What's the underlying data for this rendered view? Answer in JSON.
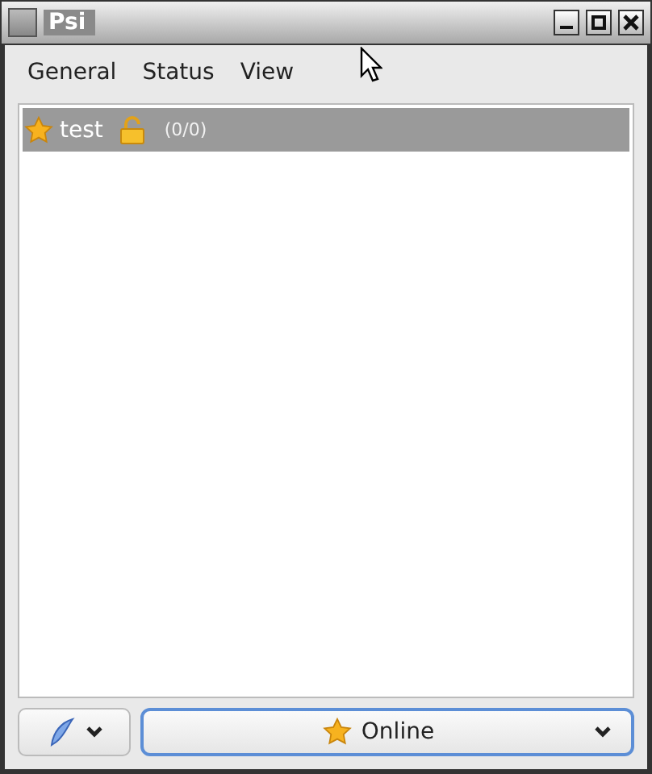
{
  "window": {
    "title": "Psi"
  },
  "menu": [
    "General",
    "Status",
    "View"
  ],
  "roster": [
    {
      "name": "test",
      "status": "(0/0)",
      "selected": true
    }
  ],
  "status_button": {
    "label": "Online"
  }
}
